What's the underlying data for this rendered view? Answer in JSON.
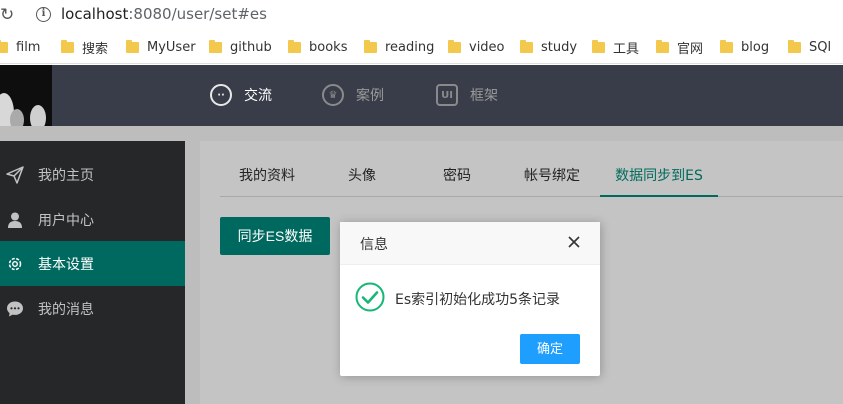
{
  "browser": {
    "url_host": "localhost",
    "url_rest": ":8080/user/set#es",
    "bookmarks": [
      "film",
      "搜索",
      "MyUser",
      "github",
      "books",
      "reading",
      "video",
      "study",
      "工具",
      "官网",
      "blog",
      "SQl"
    ]
  },
  "topnav": {
    "items": [
      {
        "label": "交流",
        "icon": "chat-icon",
        "glyph": "··"
      },
      {
        "label": "案例",
        "icon": "crown-icon",
        "glyph": "♛"
      },
      {
        "label": "框架",
        "icon": "ui-icon",
        "glyph": "UI"
      }
    ],
    "active_index": 0
  },
  "sidebar": {
    "items": [
      {
        "label": "我的主页",
        "icon": "paper-plane-icon"
      },
      {
        "label": "用户中心",
        "icon": "user-icon"
      },
      {
        "label": "基本设置",
        "icon": "gear-icon"
      },
      {
        "label": "我的消息",
        "icon": "message-icon"
      }
    ],
    "active_index": 2
  },
  "tabs": {
    "items": [
      "我的资料",
      "头像",
      "密码",
      "帐号绑定",
      "数据同步到ES"
    ],
    "active_index": 4
  },
  "main": {
    "sync_button": "同步ES数据"
  },
  "dialog": {
    "title": "信息",
    "message": "Es索引初始化成功5条记录",
    "ok_label": "确定"
  },
  "colors": {
    "accent": "#00695f",
    "topnav_bg": "#393d49",
    "sidebar_bg": "#252729",
    "ok_button": "#1e9fff",
    "success_check": "#16b777"
  }
}
